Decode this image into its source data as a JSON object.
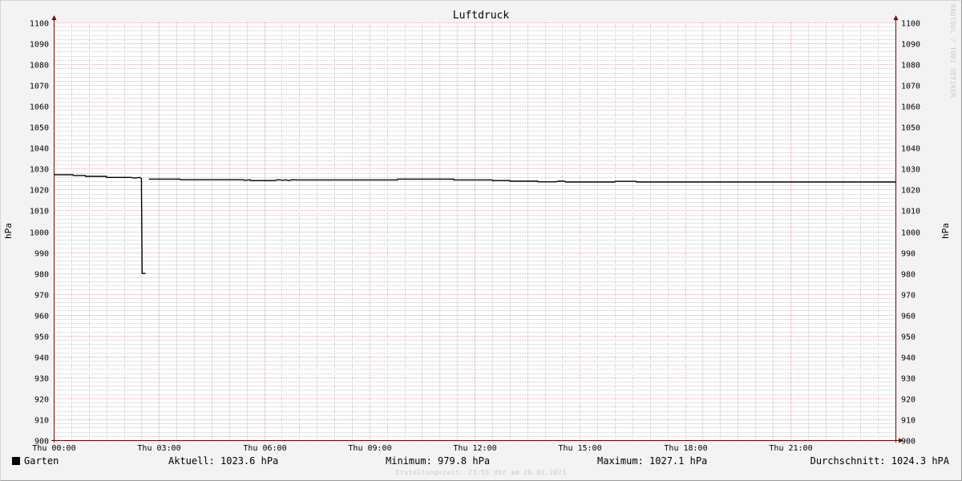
{
  "chart_data": {
    "type": "line",
    "title": "Luftdruck",
    "ylabel": "hPa",
    "ylim": [
      900,
      1100
    ],
    "y_major_step": 10,
    "y_minor_step": 2,
    "x_hours": [
      0,
      24
    ],
    "x_major_step_hours": 3,
    "x_minor_step_hours": 0.5,
    "x_ticks": [
      "Thu 00:00",
      "Thu 03:00",
      "Thu 06:00",
      "Thu 09:00",
      "Thu 12:00",
      "Thu 15:00",
      "Thu 18:00",
      "Thu 21:00"
    ],
    "grid": true,
    "series": [
      {
        "name": "Garten",
        "color": "#000000",
        "x_hours": [
          0.0,
          0.55,
          0.56,
          0.9,
          0.91,
          1.5,
          1.51,
          2.2,
          2.3,
          2.45,
          2.5,
          2.52,
          2.55,
          2.62,
          2.63,
          2.7,
          2.71,
          3.6,
          3.61,
          5.4,
          5.45,
          5.6,
          5.61,
          6.3,
          6.4,
          6.55,
          6.6,
          6.7,
          6.8,
          6.9,
          7.0,
          9.8,
          9.81,
          11.4,
          11.41,
          12.5,
          12.51,
          13.0,
          13.01,
          13.8,
          13.81,
          14.3,
          14.4,
          14.55,
          14.6,
          16.0,
          16.01,
          16.6,
          16.61,
          24.0
        ],
        "values": [
          1027.1,
          1027.1,
          1026.7,
          1026.7,
          1026.3,
          1026.3,
          1025.8,
          1025.8,
          1025.5,
          1025.8,
          1025.3,
          979.8,
          979.8,
          979.8,
          null,
          null,
          1025.0,
          1025.0,
          1024.7,
          1024.7,
          1024.4,
          1024.7,
          1024.3,
          1024.3,
          1024.7,
          1024.4,
          1024.7,
          1024.3,
          1024.7,
          1024.6,
          1024.6,
          1024.6,
          1025.0,
          1025.0,
          1024.6,
          1024.6,
          1024.3,
          1024.3,
          1024.0,
          1024.0,
          1023.7,
          1023.7,
          1024.0,
          1024.0,
          1023.6,
          1023.6,
          1023.9,
          1023.9,
          1023.6,
          1023.6
        ]
      }
    ],
    "legend": {
      "series_name": "Garten",
      "current": "Aktuell: 1023.6 hPa",
      "minimum": "Minimum: 979.8 hPa",
      "maximum": "Maximum: 1027.1 hPa",
      "average": "Durchschnitt: 1024.3 hPA"
    },
    "footer": "Erstellungszeit: 23:55 Uhr am 26.01.2023",
    "watermark": "RRDTOOL / TOBI OETIKER",
    "colors": {
      "background": "#f3f3f3",
      "plot_background": "#ffffff",
      "major_grid": "#e8a8a8",
      "minor_grid": "#c8c8c8",
      "axis": "#7a0000",
      "line": "#000000"
    }
  }
}
